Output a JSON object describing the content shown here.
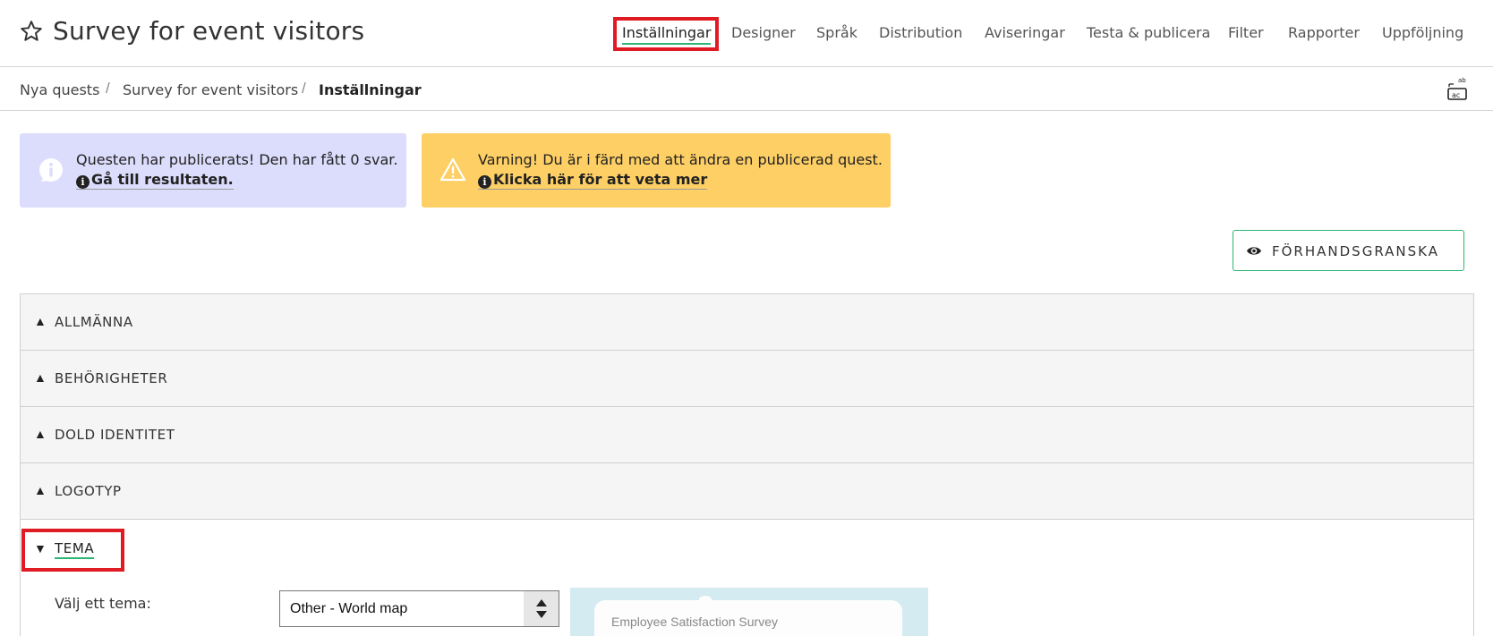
{
  "header": {
    "title": "Survey for event visitors",
    "nav": [
      {
        "label": "Inställningar",
        "active": true
      },
      {
        "label": "Designer"
      },
      {
        "label": "Språk"
      },
      {
        "label": "Distribution"
      },
      {
        "label": "Aviseringar"
      },
      {
        "label": "Testa & publicera"
      },
      {
        "label": "Filter"
      },
      {
        "label": "Rapporter"
      },
      {
        "label": "Uppföljning"
      }
    ]
  },
  "breadcrumb": {
    "items": [
      "Nya quests",
      "Survey for event visitors",
      "Inställningar"
    ],
    "separator": "/"
  },
  "alerts": {
    "info": {
      "text": "Questen har publicerats! Den har fått 0 svar.",
      "link": "Gå till resultaten.",
      "color": "#dcdcfc",
      "icon": "info-icon"
    },
    "warning": {
      "text": "Varning! Du är i färd med att ändra en publicerad quest.",
      "link": "Klicka här för att veta mer",
      "color": "#fecf64",
      "icon": "warning-triangle-icon"
    }
  },
  "preview_button": {
    "label": "FÖRHANDSGRANSKA",
    "icon": "eye-icon"
  },
  "accordion": {
    "sections": [
      {
        "label": "ALLMÄNNA",
        "expanded": false
      },
      {
        "label": "BEHÖRIGHETER",
        "expanded": false
      },
      {
        "label": "DOLD IDENTITET",
        "expanded": false
      },
      {
        "label": "LOGOTYP",
        "expanded": false
      },
      {
        "label": "TEMA",
        "expanded": true
      }
    ]
  },
  "theme": {
    "label": "Välj ett tema:",
    "selected": "Other - World map",
    "preview_title": "Employee Satisfaction Survey"
  },
  "colors": {
    "accent": "#2bb673",
    "highlight": "#e01b24"
  }
}
